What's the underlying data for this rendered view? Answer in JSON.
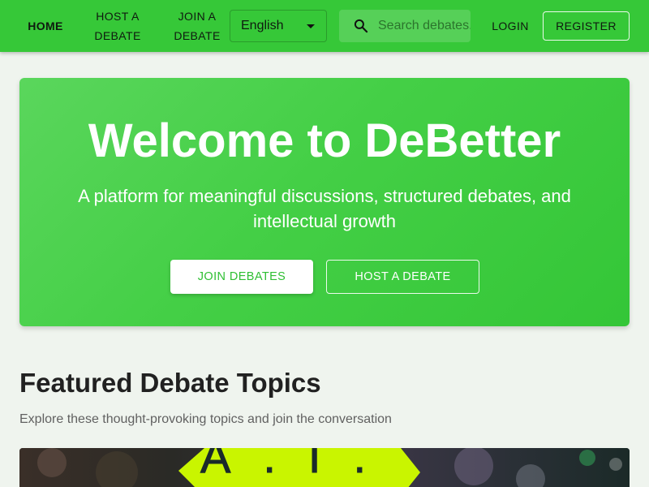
{
  "nav": {
    "home": "HOME",
    "host_debate_line1": "HOST A",
    "host_debate_line2": "DEBATE",
    "join_debate_line1": "JOIN A",
    "join_debate_line2": "DEBATE",
    "language": "English",
    "search_placeholder": "Search debates...",
    "login": "LOGIN",
    "register": "REGISTER"
  },
  "hero": {
    "title": "Welcome to DeBetter",
    "subtitle_line1": "A platform for meaningful discussions, structured debates, and",
    "subtitle_line2": "intellectual growth",
    "join_button": "JOIN DEBATES",
    "host_button": "HOST A DEBATE"
  },
  "featured": {
    "title": "Featured Debate Topics",
    "subtitle": "Explore these thought-provoking topics and join the conversation",
    "card_image_text": "A.I."
  },
  "colors": {
    "brand_green": "#36c838",
    "hero_green": "#44cf46",
    "sticky_note": "#c9f500",
    "background": "#eff4ee"
  },
  "icons": {
    "search": "search-icon",
    "dropdown": "chevron-down-icon"
  }
}
